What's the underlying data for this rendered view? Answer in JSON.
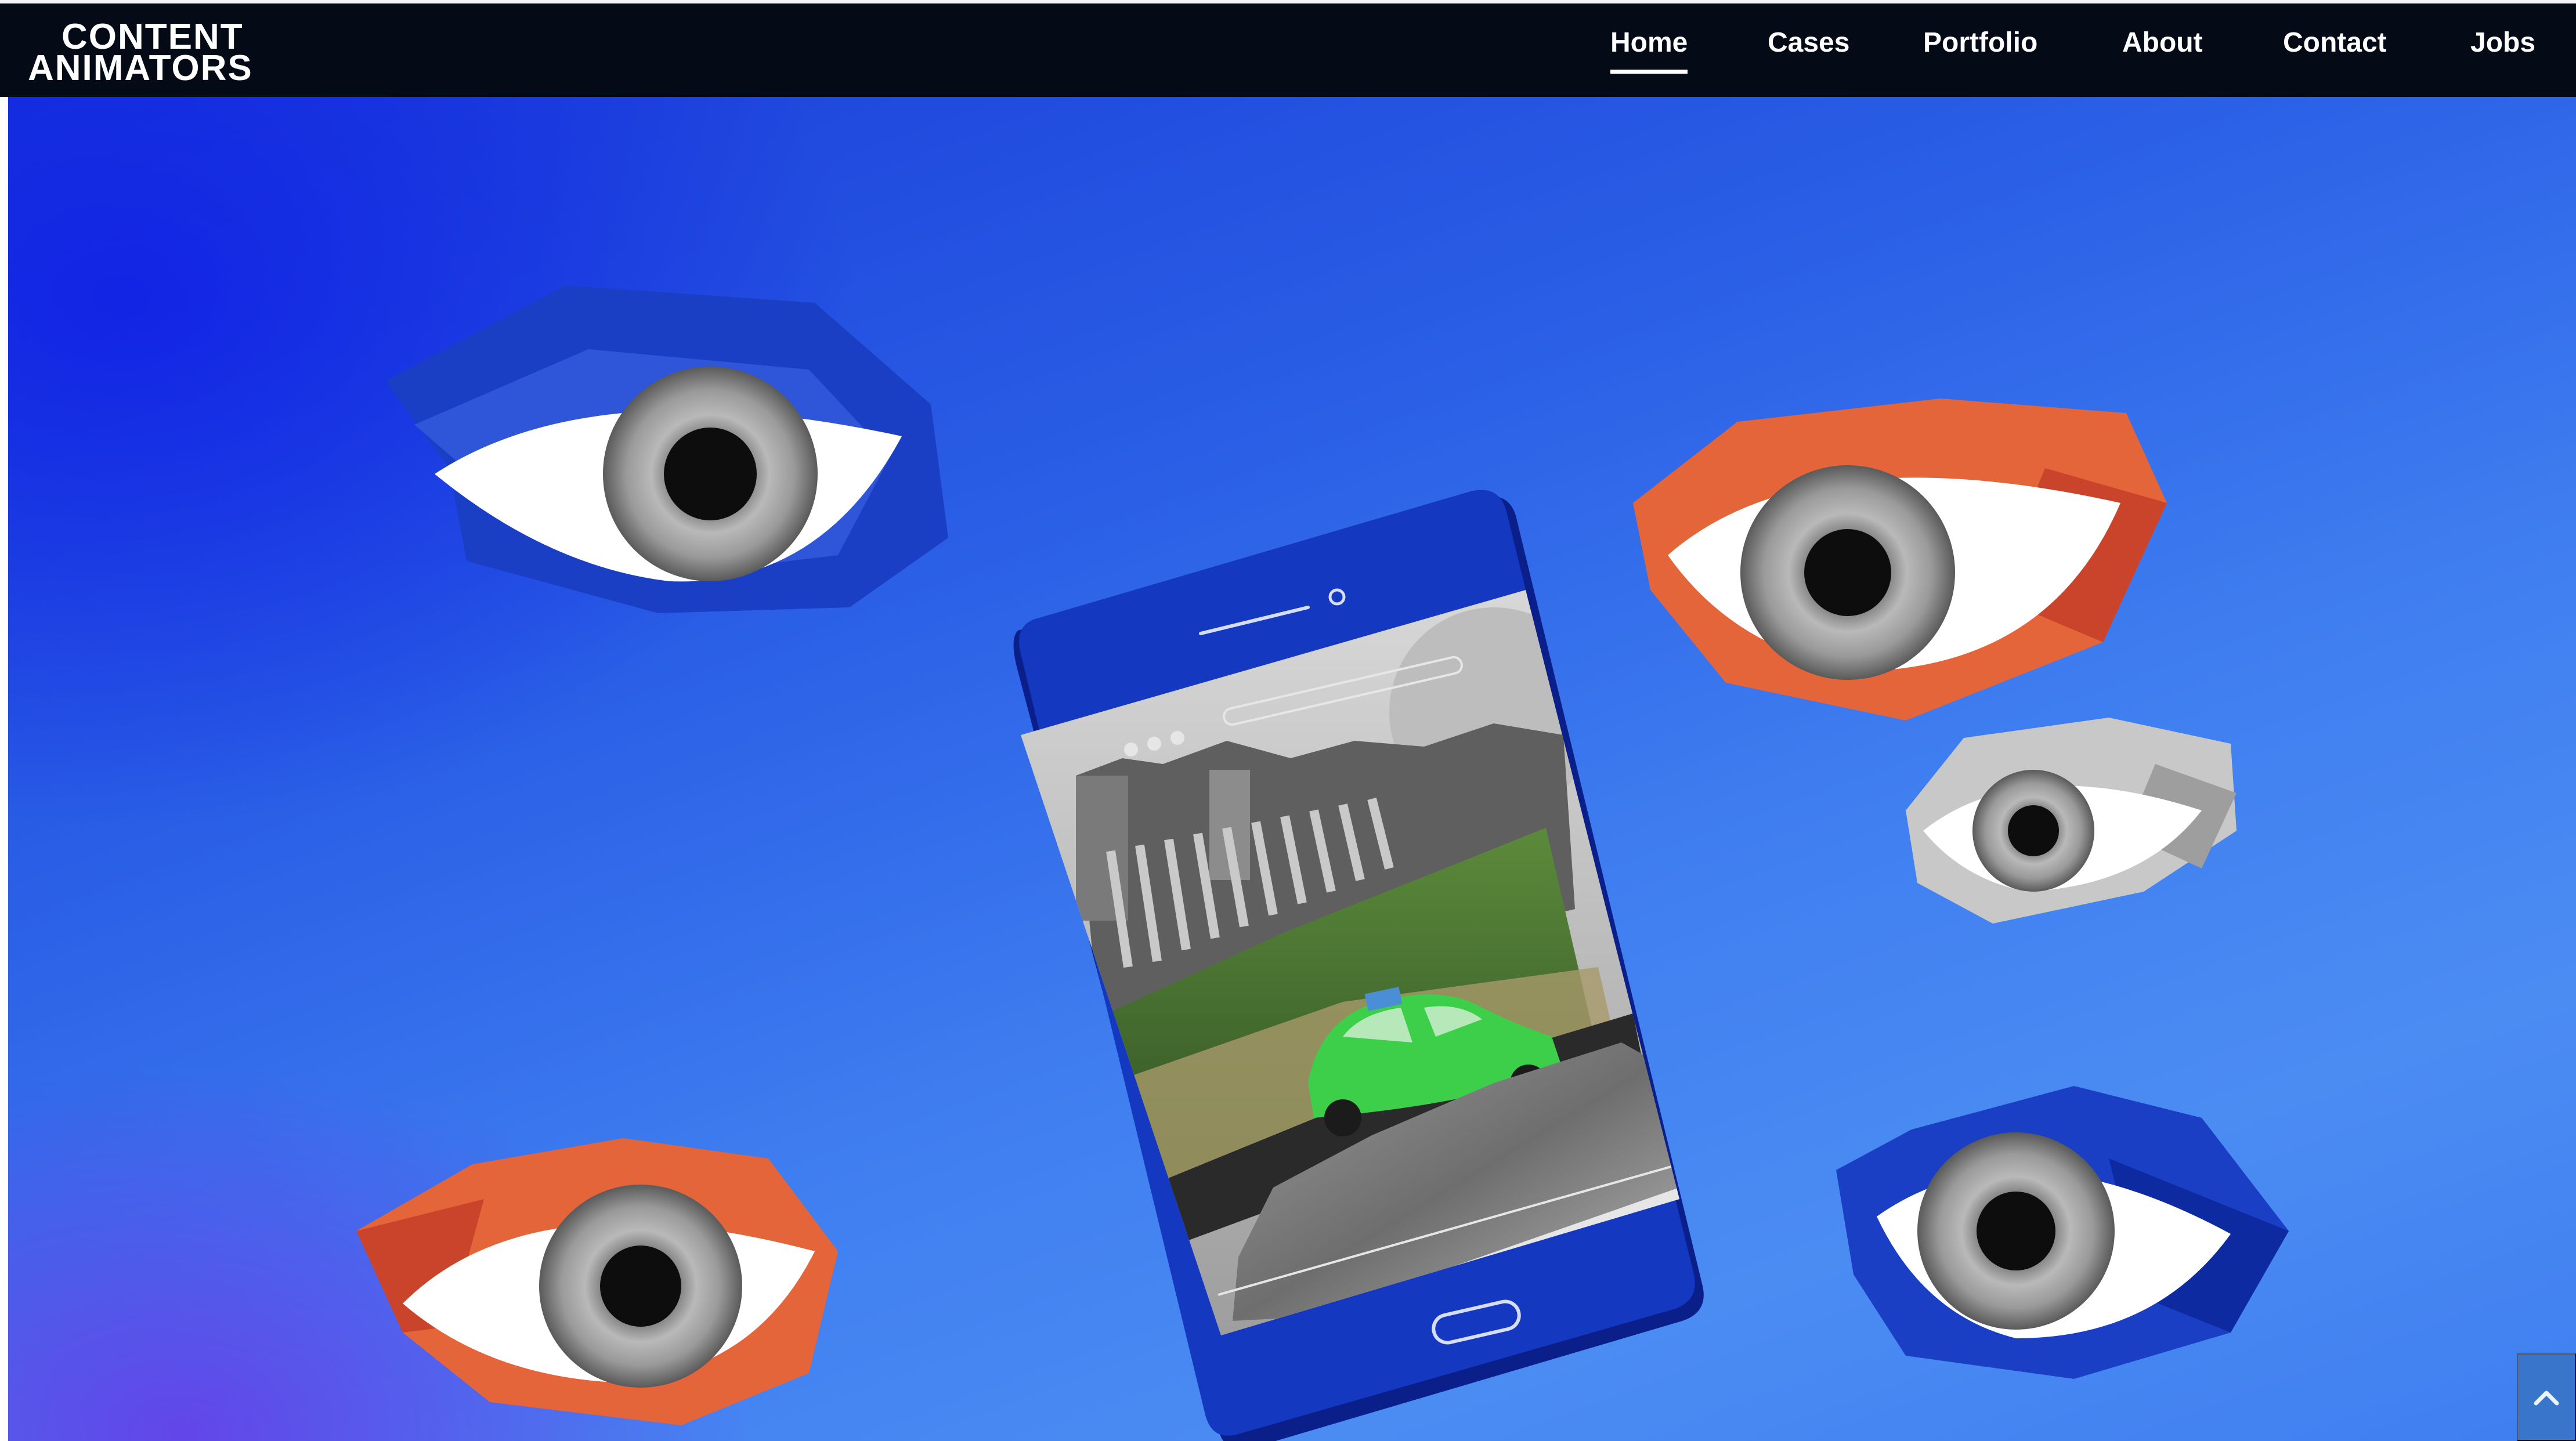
{
  "brand": {
    "logo_line1": "CONTENT",
    "logo_line2": "ANIMATORS"
  },
  "nav": {
    "items": [
      {
        "label": "Home",
        "active": true
      },
      {
        "label": "Cases",
        "active": false
      },
      {
        "label": "Portfolio",
        "active": false
      },
      {
        "label": "About",
        "active": false
      },
      {
        "label": "Contact",
        "active": false
      },
      {
        "label": "Jobs",
        "active": false
      }
    ]
  },
  "hero": {
    "illustration": "phone-with-floating-eyes",
    "eyes": [
      {
        "color": "#1a3fc4",
        "name": "blue-eye-top-left"
      },
      {
        "color": "#e5653a",
        "name": "orange-eye-top-right"
      },
      {
        "color": "#bdbdbd",
        "name": "gray-eye-right"
      },
      {
        "color": "#e5653a",
        "name": "orange-eye-bottom-left"
      },
      {
        "color": "#1a3fc4",
        "name": "blue-eye-bottom-right"
      }
    ]
  },
  "controls": {
    "scroll_top_icon": "chevron-up-icon"
  },
  "colors": {
    "nav_bg": "#050a17",
    "hero_blue": "#2a5fe6",
    "accent_orange": "#e5653a",
    "phone_blue": "#1438c0"
  }
}
